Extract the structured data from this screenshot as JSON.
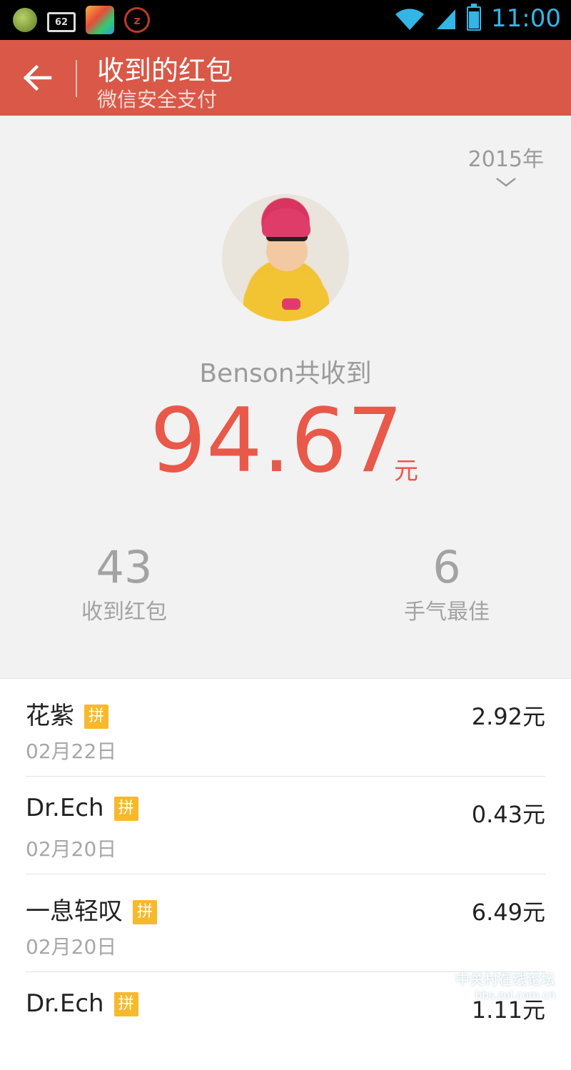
{
  "status_bar": {
    "notification_62": "62",
    "alarm_letter": "z",
    "time": "11:00"
  },
  "toolbar": {
    "title": "收到的红包",
    "subtitle": "微信安全支付"
  },
  "summary": {
    "year": "2015年",
    "receiver_label": "Benson共收到",
    "total_amount": "94.67",
    "total_unit": "元",
    "stats": {
      "received_count": "43",
      "received_label": "收到红包",
      "best_count": "6",
      "best_label": "手气最佳"
    }
  },
  "list": {
    "items": [
      {
        "name": "花紫",
        "tag": "拼",
        "date": "02月22日",
        "amount": "2.92元"
      },
      {
        "name": "Dr.Ech",
        "tag": "拼",
        "date": "02月20日",
        "amount": "0.43元"
      },
      {
        "name": "一息轻叹",
        "tag": "拼",
        "date": "02月20日",
        "amount": "6.49元"
      },
      {
        "name": "Dr.Ech",
        "tag": "拼",
        "date": "",
        "amount": "1.11元"
      }
    ]
  },
  "watermark": {
    "line1": "中关村在线论坛",
    "line2": "bbs.zol.com.cn"
  },
  "colors": {
    "toolbar": "#d95848",
    "accent_amount": "#e8594a",
    "tag": "#f7b92c",
    "status_icons": "#33b5e5"
  },
  "icons": [
    "message-icon",
    "app-62-icon",
    "app-store-icon",
    "alarm-icon",
    "wifi-icon",
    "signal-icon",
    "battery-icon",
    "back-arrow-icon",
    "chevron-down-icon",
    "avatar"
  ]
}
